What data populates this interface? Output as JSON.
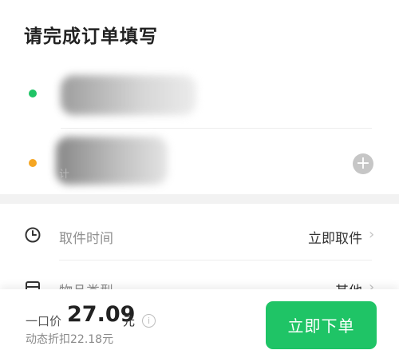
{
  "page": {
    "title": "请完成订单填写"
  },
  "sender": {
    "dot_color": "#1fc466"
  },
  "receiver": {
    "dot_color": "#f5a623",
    "hint": "计"
  },
  "pickup_time": {
    "label": "取件时间",
    "value": "立即取件"
  },
  "item_type": {
    "label": "物品类型",
    "value": "其他"
  },
  "bottom": {
    "price_prefix": "一口价",
    "price": "27.09",
    "unit": "元",
    "discount_text": "动态折扣22.18元",
    "order_button": "立即下单",
    "accent_color": "#1fc466"
  }
}
